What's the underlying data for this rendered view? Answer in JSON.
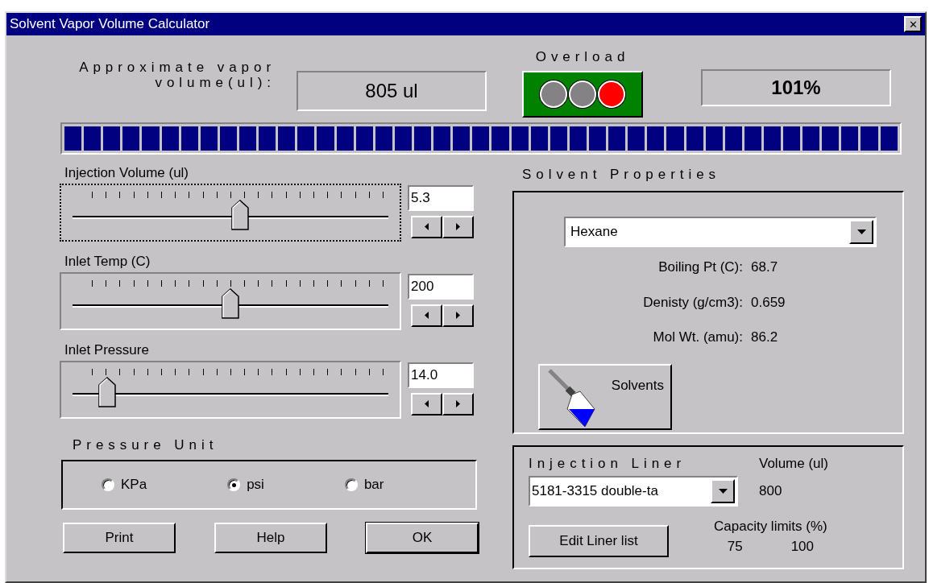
{
  "window": {
    "title": "Solvent Vapor Volume Calculator",
    "close": "✕"
  },
  "vapor_volume": {
    "label_line1": "Approximate vapor",
    "label_line2": "volume(ul):",
    "value": "805 ul"
  },
  "overload": {
    "label": "Overload",
    "lights": [
      {
        "on": false
      },
      {
        "on": false
      },
      {
        "on": true
      }
    ]
  },
  "capacity_percent": "101%",
  "capacity_bar": {
    "level": 1
  },
  "sliders": [
    {
      "label": "Injection Volume (ul)",
      "value": "5.3",
      "level": 0.53,
      "focused": true
    },
    {
      "label": "Inlet Temp (C)",
      "value": "200",
      "level": 0.5,
      "focused": false
    },
    {
      "label": "Inlet Pressure",
      "value": "14.0",
      "level": 0.11,
      "focused": false
    }
  ],
  "pressure_unit": {
    "label": "Pressure Unit",
    "options": [
      {
        "label": "KPa",
        "selected": false
      },
      {
        "label": "psi",
        "selected": true
      },
      {
        "label": "bar",
        "selected": false
      }
    ]
  },
  "buttons": [
    "Print",
    "Help",
    "OK"
  ],
  "solvent_properties": {
    "label": "Solvent  Properties",
    "solvent": "Hexane",
    "properties": [
      {
        "label": "Boiling Pt (C):",
        "value": "68.7"
      },
      {
        "label": "Denisty (g/cm3):",
        "value": "0.659"
      },
      {
        "label": "Mol Wt. (amu):",
        "value": "86.2"
      }
    ],
    "solvents_button": "Solvents"
  },
  "injection_liner": {
    "label": "Injection Liner",
    "liner": "5181-3315 double-ta",
    "volume_label": "Volume (ul)",
    "volume": "800",
    "edit_button": "Edit Liner list",
    "capacity_label": "Capacity limits (%)",
    "capacity_low": "75",
    "capacity_high": "100"
  }
}
